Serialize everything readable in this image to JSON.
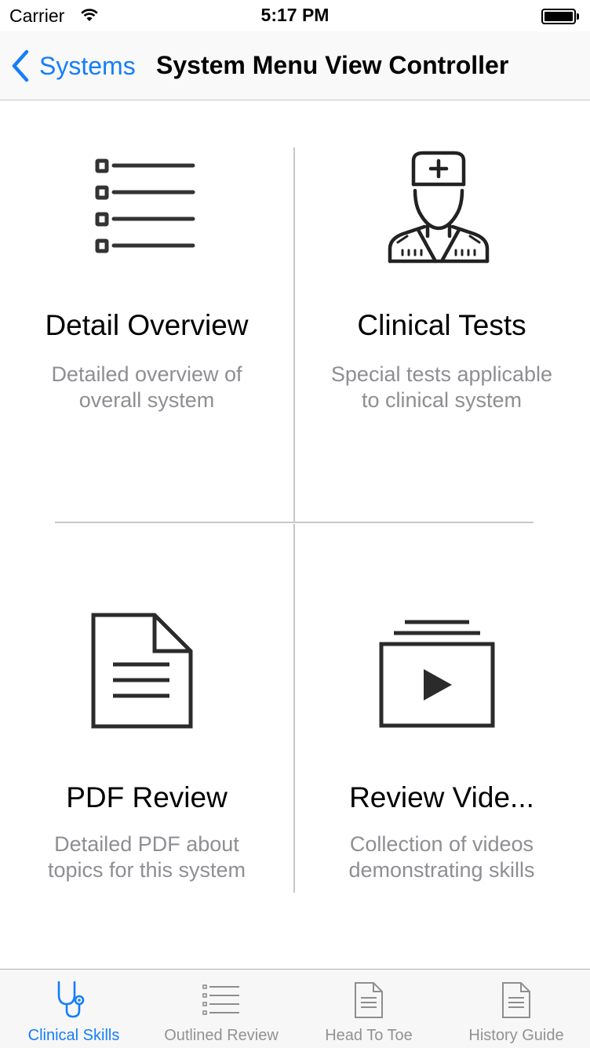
{
  "status_bar": {
    "carrier": "Carrier",
    "time": "5:17 PM"
  },
  "nav": {
    "back_label": "Systems",
    "title": "System Menu View Controller"
  },
  "menu": [
    {
      "icon": "list-icon",
      "title": "Detail Overview",
      "subtitle_lines": [
        "Detailed overview of",
        "overall system"
      ]
    },
    {
      "icon": "doctor-icon",
      "title": "Clinical Tests",
      "subtitle_lines": [
        "Special tests applicable",
        "to clinical system"
      ]
    },
    {
      "icon": "document-icon",
      "title": "PDF Review",
      "subtitle_lines": [
        "Detailed PDF about",
        "topics for this system"
      ]
    },
    {
      "icon": "video-stack-icon",
      "title": "Review Vide...",
      "subtitle_lines": [
        "Collection of videos",
        "demonstrating skills"
      ]
    }
  ],
  "tabs": [
    {
      "icon": "stethoscope-icon",
      "label": "Clinical Skills",
      "active": true
    },
    {
      "icon": "list-icon",
      "label": "Outlined Review",
      "active": false
    },
    {
      "icon": "document-icon",
      "label": "Head To Toe",
      "active": false
    },
    {
      "icon": "document-icon",
      "label": "History Guide",
      "active": false
    }
  ],
  "colors": {
    "accent": "#147efb",
    "inactive": "#929292",
    "divider": "#c7c7cc",
    "subtitle": "#8e8e93"
  }
}
